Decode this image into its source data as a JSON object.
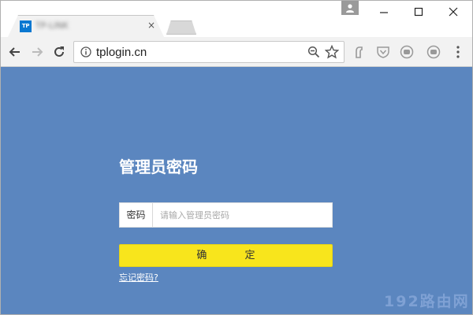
{
  "browser": {
    "tab": {
      "favicon_text": "TP",
      "title": "TP-LINK",
      "close_glyph": "×"
    },
    "address": {
      "url": "tplogin.cn"
    },
    "colors": {
      "page_background": "#5b86bf",
      "button_yellow": "#f8e51c",
      "favicon_blue": "#0a78d1"
    },
    "icons": [
      "back-arrow-icon",
      "forward-arrow-icon",
      "reload-icon",
      "info-icon",
      "zoom-icon",
      "star-icon",
      "extension-icon",
      "shield-icon",
      "ghost-icon",
      "ghost-icon",
      "menu-icon",
      "minimize-icon",
      "maximize-icon",
      "close-icon",
      "profile-icon"
    ]
  },
  "login": {
    "title": "管理员密码",
    "password_label": "密码",
    "password_placeholder": "请输入管理员密码",
    "confirm_label": "确 定",
    "forgot_link": "忘记密码?"
  },
  "watermark": "192路由网"
}
